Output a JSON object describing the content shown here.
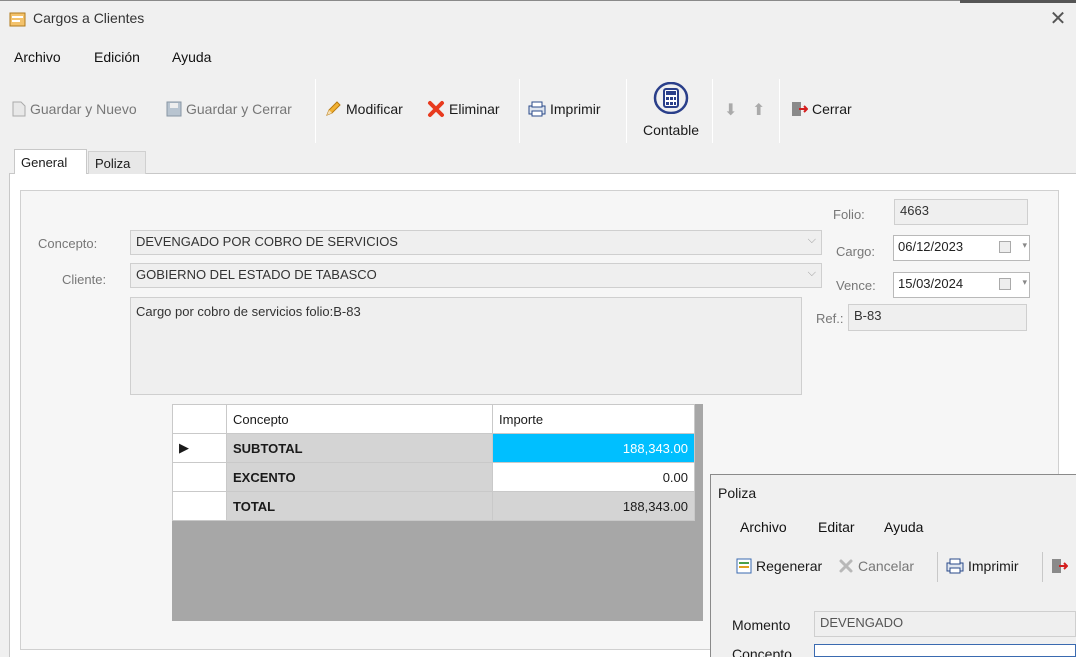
{
  "window": {
    "title": "Cargos a Clientes",
    "close": "✕"
  },
  "menu": [
    "Archivo",
    "Edición",
    "Ayuda"
  ],
  "toolbar": {
    "guardar_nuevo": "Guardar y Nuevo",
    "guardar_cerrar": "Guardar y Cerrar",
    "modificar": "Modificar",
    "eliminar": "Eliminar",
    "imprimir": "Imprimir",
    "contable": "Contable",
    "cerrar": "Cerrar"
  },
  "tabs": [
    "General",
    "Poliza"
  ],
  "form": {
    "folio_label": "Folio:",
    "folio": "4663",
    "concepto_label": "Concepto:",
    "concepto": "DEVENGADO POR COBRO DE SERVICIOS",
    "cliente_label": "Cliente:",
    "cliente": "GOBIERNO DEL ESTADO DE TABASCO",
    "cargo_label": "Cargo:",
    "cargo": "06/12/2023",
    "vence_label": "Vence:",
    "vence": "15/03/2024",
    "ref_label": "Ref.:",
    "ref": "B-83",
    "descripcion": "Cargo por cobro de servicios folio:B-83"
  },
  "grid": {
    "headers": [
      "Concepto",
      "Importe"
    ],
    "rows": [
      {
        "concepto": "SUBTOTAL",
        "importe": "188,343.00"
      },
      {
        "concepto": "EXCENTO",
        "importe": "0.00"
      },
      {
        "concepto": "TOTAL",
        "importe": "188,343.00"
      }
    ]
  },
  "poliza": {
    "title": "Poliza",
    "menu": [
      "Archivo",
      "Editar",
      "Ayuda"
    ],
    "regenerar": "Regenerar",
    "cancelar": "Cancelar",
    "imprimir": "Imprimir",
    "momento_label": "Momento",
    "momento": "DEVENGADO",
    "concepto_label": "Concepto"
  }
}
